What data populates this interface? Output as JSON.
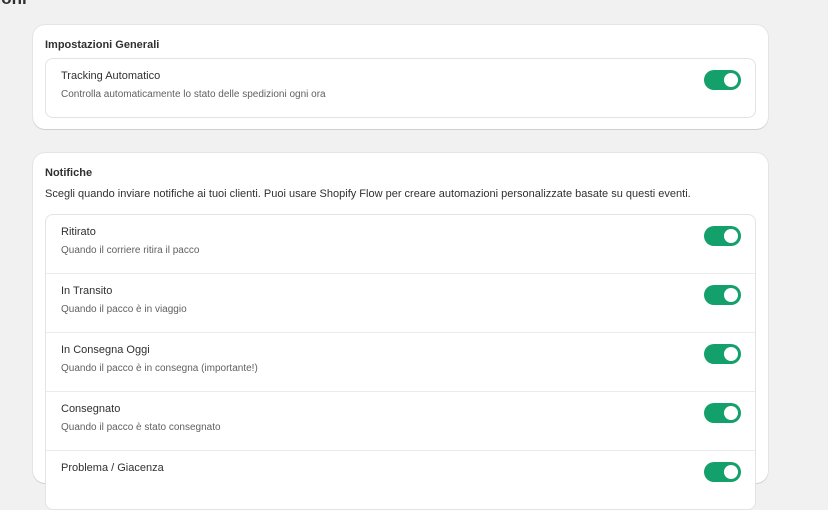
{
  "page": {
    "title": "zioni"
  },
  "general": {
    "title": "Impostazioni Generali",
    "items": [
      {
        "title": "Tracking Automatico",
        "subtitle": "Controlla automaticamente lo stato delle spedizioni ogni ora",
        "enabled": true
      }
    ]
  },
  "notifications": {
    "title": "Notifiche",
    "description": "Scegli quando inviare notifiche ai tuoi clienti. Puoi usare Shopify Flow per creare automazioni personalizzate basate su questi eventi.",
    "items": [
      {
        "title": "Ritirato",
        "subtitle": "Quando il corriere ritira il pacco",
        "enabled": true
      },
      {
        "title": "In Transito",
        "subtitle": "Quando il pacco è in viaggio",
        "enabled": true
      },
      {
        "title": "In Consegna Oggi",
        "subtitle": "Quando il pacco è in consegna (importante!)",
        "enabled": true
      },
      {
        "title": "Consegnato",
        "subtitle": "Quando il pacco è stato consegnato",
        "enabled": true
      },
      {
        "title": "Problema / Giacenza",
        "subtitle": "",
        "enabled": true
      }
    ]
  },
  "colors": {
    "toggle_on": "#13a06a",
    "background": "#f1f1f1"
  }
}
